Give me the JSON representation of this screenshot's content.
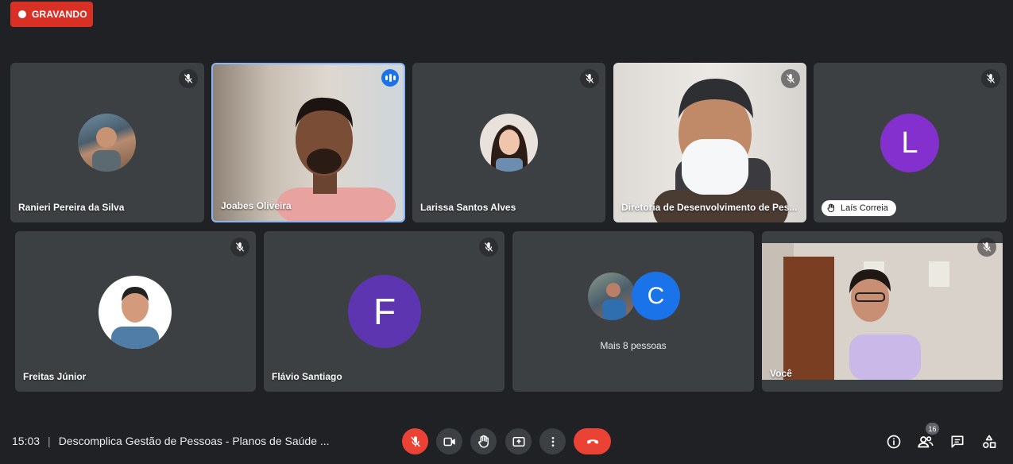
{
  "recording": {
    "label": "GRAVANDO"
  },
  "participants": [
    {
      "name": "Ranieri Pereira da Silva"
    },
    {
      "name": "Joabes Oliveira"
    },
    {
      "name": "Larissa Santos Alves"
    },
    {
      "name": "Diretoria de Desenvolvimento de Pes..."
    },
    {
      "name": "Laís Correia",
      "initial": "L",
      "color": "#8430ce"
    },
    {
      "name": "Freitas Júnior"
    },
    {
      "name": "Flávio Santiago",
      "initial": "F",
      "color": "#5e35b1"
    },
    {
      "name": "Você"
    }
  ],
  "more": {
    "label": "Mais 8 pessoas",
    "initial": "C",
    "color": "#1a73e8"
  },
  "bottom_bar": {
    "time": "15:03",
    "separator": "|",
    "meeting_title": "Descomplica Gestão de Pessoas - Planos de Saúde ...",
    "participant_count": "16"
  }
}
